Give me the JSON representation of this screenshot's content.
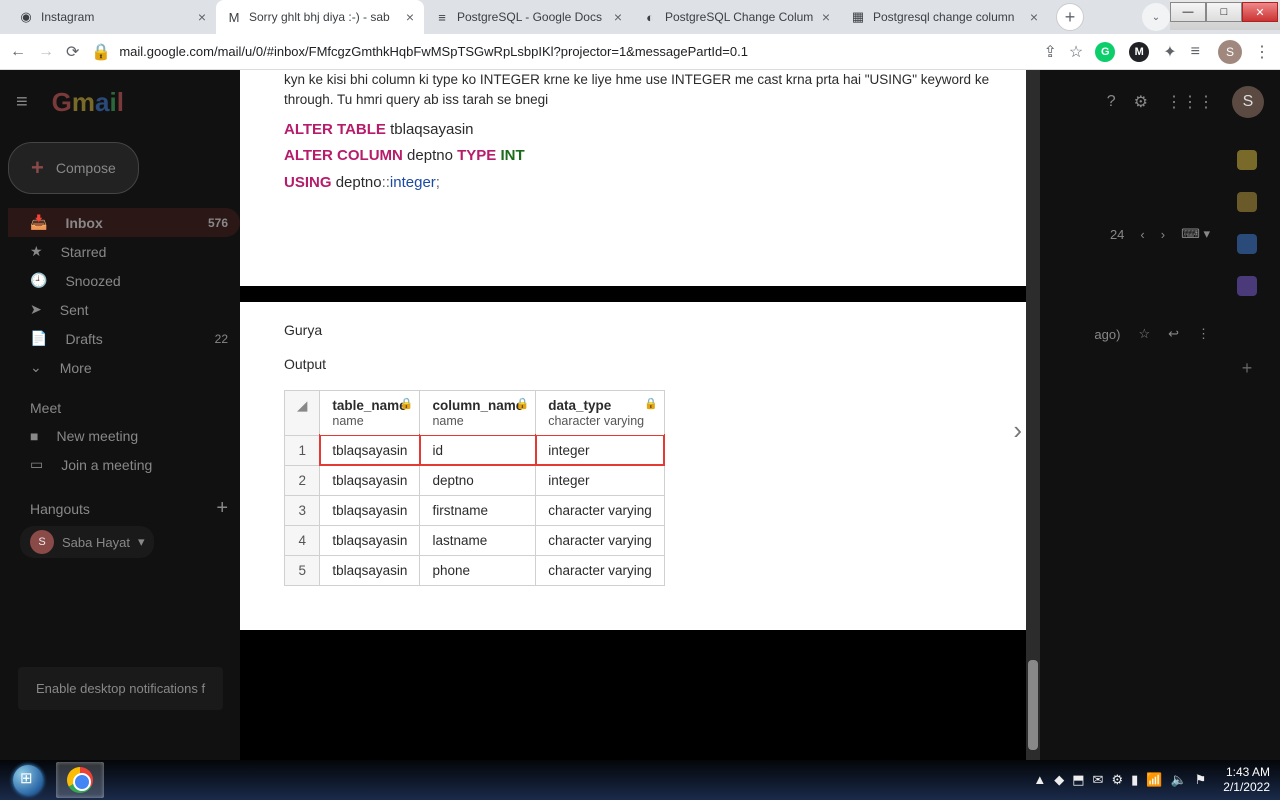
{
  "window_controls": {
    "min": "—",
    "max": "□",
    "close": "✕"
  },
  "tabs": [
    {
      "title": "Instagram",
      "favicon": "◉"
    },
    {
      "title": "Sorry ghlt bhj diya :-) - sab",
      "favicon": "M",
      "active": true
    },
    {
      "title": "PostgreSQL - Google Docs",
      "favicon": "≡"
    },
    {
      "title": "PostgreSQL Change Colum",
      "favicon": "◐"
    },
    {
      "title": "Postgresql change column",
      "favicon": "▦"
    }
  ],
  "newtab": "+",
  "profile_chev": "⌄",
  "omnibox": {
    "back": "←",
    "fwd": "→",
    "reload": "⟳",
    "lock": "🔒",
    "url": "mail.google.com/mail/u/0/#inbox/FMfcgzGmthkHqbFwMSpTSGwRpLsbpIKl?projector=1&messagePartId=0.1",
    "share": "⇪",
    "star": "☆",
    "ext": [
      "G",
      "M",
      "✦",
      "≡"
    ],
    "profile": "S",
    "menu": "⋮"
  },
  "gmail": {
    "menu": "≡",
    "logo": "Gmail",
    "help": "?",
    "settings": "⚙",
    "apps": "⋮⋮⋮",
    "avatar": "S",
    "compose": "Compose",
    "sidebar": [
      {
        "icon": "📥",
        "label": "Inbox",
        "count": "576",
        "active": true
      },
      {
        "icon": "★",
        "label": "Starred"
      },
      {
        "icon": "🕘",
        "label": "Snoozed"
      },
      {
        "icon": "➤",
        "label": "Sent"
      },
      {
        "icon": "📄",
        "label": "Drafts",
        "count": "22"
      },
      {
        "icon": "⌄",
        "label": "More"
      }
    ],
    "meet": {
      "title": "Meet",
      "new": "New meeting",
      "join": "Join a meeting"
    },
    "hangouts": {
      "title": "Hangouts",
      "name": "Saba Hayat",
      "chev": "▾"
    },
    "notif": "Enable desktop notifications f",
    "inbox_meta": {
      "text": "24",
      "prev": "‹",
      "next": "›"
    },
    "msg_meta": {
      "ago": "ago)",
      "star": "☆",
      "reply": "↩",
      "more": "⋮"
    }
  },
  "document": {
    "para1": "kyn ke kisi bhi column ki type ko INTEGER krne ke liye hme use INTEGER me cast krna prta hai \"USING\" keyword ke through. Tu hmri query ab iss tarah se bnegi",
    "sql": {
      "l1a": "ALTER TABLE",
      "l1b": "tblaqsayasin",
      "l2a": "ALTER COLUMN",
      "l2b": "deptno",
      "l2c": "TYPE",
      "l2d": "INT",
      "l3a": "USING",
      "l3b": "deptno",
      "l3c": "::",
      "l3d": "integer",
      "l3e": ";"
    },
    "author": "Gurya",
    "output_h": "Output",
    "table": {
      "headers": [
        {
          "name": "table_name",
          "type": "name"
        },
        {
          "name": "column_name",
          "type": "name"
        },
        {
          "name": "data_type",
          "type": "character varying"
        }
      ],
      "rows": [
        {
          "n": "1",
          "c": [
            "tblaqsayasin",
            "id",
            "integer"
          ],
          "hl": true
        },
        {
          "n": "2",
          "c": [
            "tblaqsayasin",
            "deptno",
            "integer"
          ]
        },
        {
          "n": "3",
          "c": [
            "tblaqsayasin",
            "firstname",
            "character varying"
          ]
        },
        {
          "n": "4",
          "c": [
            "tblaqsayasin",
            "lastname",
            "character varying"
          ]
        },
        {
          "n": "5",
          "c": [
            "tblaqsayasin",
            "phone",
            "character varying"
          ]
        }
      ],
      "lock": "🔒",
      "tri": "◢"
    },
    "nav": "›"
  },
  "taskbar": {
    "tray_icons": [
      "▲",
      "◆",
      "⬒",
      "✉",
      "⚙",
      "▮",
      "📶",
      "🔈",
      "⚑"
    ],
    "time": "1:43 AM",
    "date": "2/1/2022"
  }
}
